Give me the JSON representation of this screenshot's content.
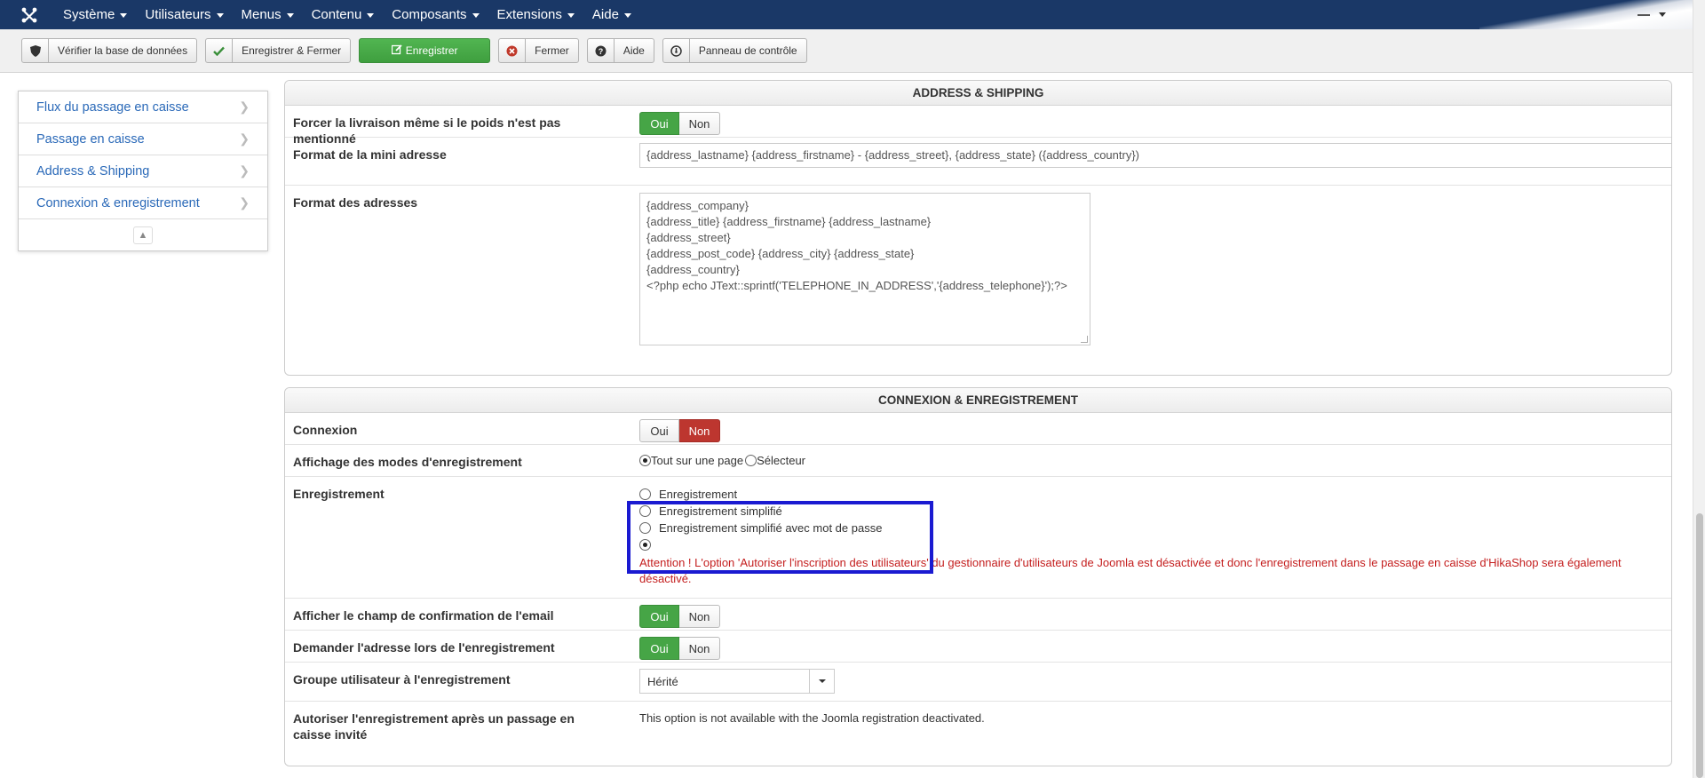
{
  "navbar": {
    "menus": [
      {
        "label": "Système"
      },
      {
        "label": "Utilisateurs"
      },
      {
        "label": "Menus"
      },
      {
        "label": "Contenu"
      },
      {
        "label": "Composants"
      },
      {
        "label": "Extensions"
      },
      {
        "label": "Aide"
      }
    ]
  },
  "toolbar": {
    "check_db": "Vérifier la base de données",
    "save_close": "Enregistrer & Fermer",
    "save": "Enregistrer",
    "close": "Fermer",
    "help": "Aide",
    "control_panel": "Panneau de contrôle"
  },
  "sidebar": {
    "items": [
      {
        "label": "Flux du passage en caisse"
      },
      {
        "label": "Passage en caisse"
      },
      {
        "label": "Address & Shipping"
      },
      {
        "label": "Connexion & enregistrement"
      }
    ]
  },
  "yesno": {
    "yes": "Oui",
    "no": "Non"
  },
  "address": {
    "title": "ADDRESS & SHIPPING",
    "force_shipping_label": "Forcer la livraison même si le poids n'est pas mentionné",
    "force_shipping_value": "Oui",
    "mini_format_label": "Format de la mini adresse",
    "mini_format_value": "{address_lastname} {address_firstname} - {address_street}, {address_state} ({address_country})",
    "format_label": "Format des adresses",
    "format_value": "{address_company}\n{address_title} {address_firstname} {address_lastname}\n{address_street}\n{address_post_code} {address_city} {address_state}\n{address_country}\n<?php echo JText::sprintf('TELEPHONE_IN_ADDRESS','{address_telephone}');?>"
  },
  "login": {
    "title": "CONNEXION & ENREGISTREMENT",
    "connexion_label": "Connexion",
    "connexion_value": "Non",
    "display_modes_label": "Affichage des modes d'enregistrement",
    "display_modes_options": [
      "Tout sur une page",
      "Sélecteur"
    ],
    "display_modes_selected": "Tout sur une page",
    "registration_label": "Enregistrement",
    "registration_options": [
      "Enregistrement",
      "Enregistrement simplifié",
      "Enregistrement simplifié avec mot de passe",
      ""
    ],
    "registration_warning": "Attention ! L'option 'Autoriser l'inscription des utilisateurs' du gestionnaire d'utilisateurs de Joomla est désactivée et donc l'enregistrement dans le passage en caisse d'HikaShop sera également désactivé.",
    "email_confirm_label": "Afficher le champ de confirmation de l'email",
    "email_confirm_value": "Oui",
    "ask_address_label": "Demander l'adresse lors de l'enregistrement",
    "ask_address_value": "Oui",
    "user_group_label": "Groupe utilisateur à l'enregistrement",
    "user_group_value": "Hérité",
    "guest_register_label": "Autoriser l'enregistrement après un passage en caisse invité",
    "guest_register_text": "This option is not available with the Joomla registration deactivated."
  }
}
